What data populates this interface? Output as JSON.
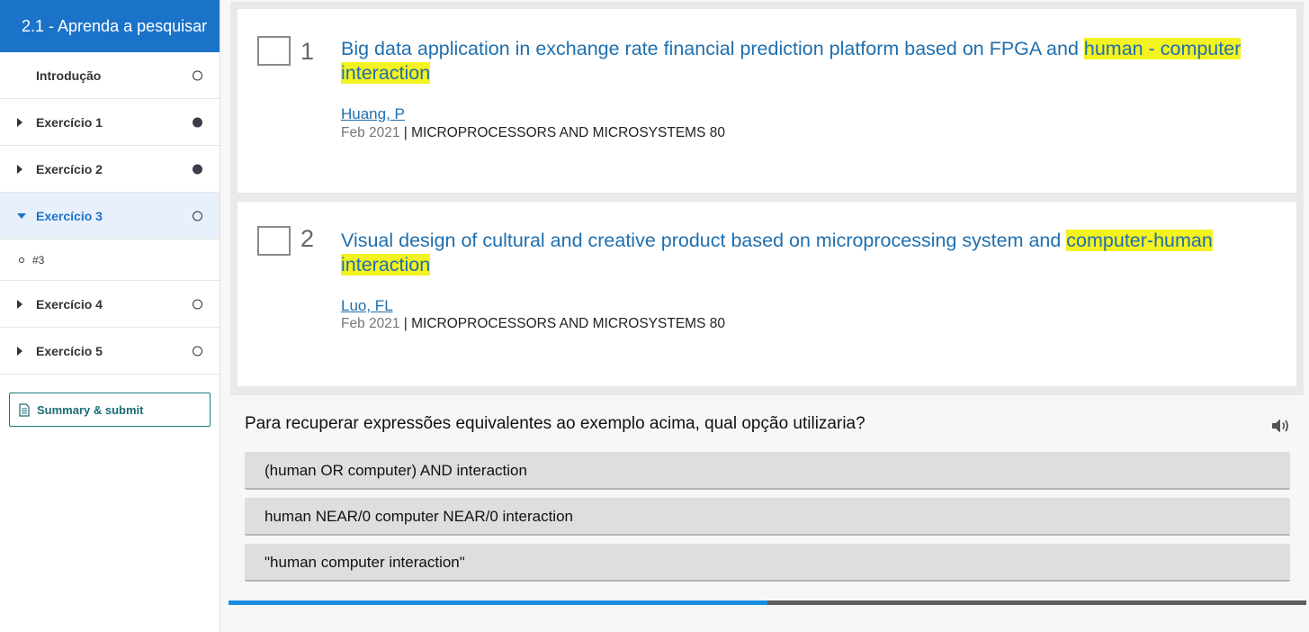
{
  "sidebar": {
    "header": "2.1 - Aprenda a pesquisar",
    "items": [
      {
        "label": "Introdução",
        "status": "empty"
      },
      {
        "label": "Exercício 1",
        "status": "filled"
      },
      {
        "label": "Exercício 2",
        "status": "filled"
      },
      {
        "label": "Exercício 3",
        "status": "empty",
        "active": true
      },
      {
        "label": "#3"
      },
      {
        "label": "Exercício 4",
        "status": "empty"
      },
      {
        "label": "Exercício 5",
        "status": "empty"
      }
    ],
    "summary_label": "Summary & submit"
  },
  "results": [
    {
      "number": "1",
      "title_plain": "Big data application in exchange rate financial prediction platform based on FPGA and ",
      "title_highlight": "human - computer interaction",
      "author": "Huang, P",
      "date": "Feb 2021",
      "separator": " | ",
      "journal": "MICROPROCESSORS AND MICROSYSTEMS 80"
    },
    {
      "number": "2",
      "title_plain": "Visual design of cultural and creative product based on microprocessing system and ",
      "title_highlight": "computer-human interaction",
      "author": "Luo, FL",
      "date": "Feb 2021",
      "separator": " | ",
      "journal": "MICROPROCESSORS AND MICROSYSTEMS 80"
    }
  ],
  "question": "Para recuperar expressões equivalentes ao exemplo acima, qual opção utilizaria?",
  "options": [
    "(human OR computer) AND interaction",
    "human NEAR/0 computer NEAR/0 interaction",
    "\"human computer interaction\""
  ],
  "progress": 0.5,
  "colors": {
    "accent": "#1a73c9",
    "highlight": "#f4f21f",
    "link": "#1f6fae",
    "progress_fill": "#1a8de0",
    "progress_track": "#5e5e5e"
  }
}
